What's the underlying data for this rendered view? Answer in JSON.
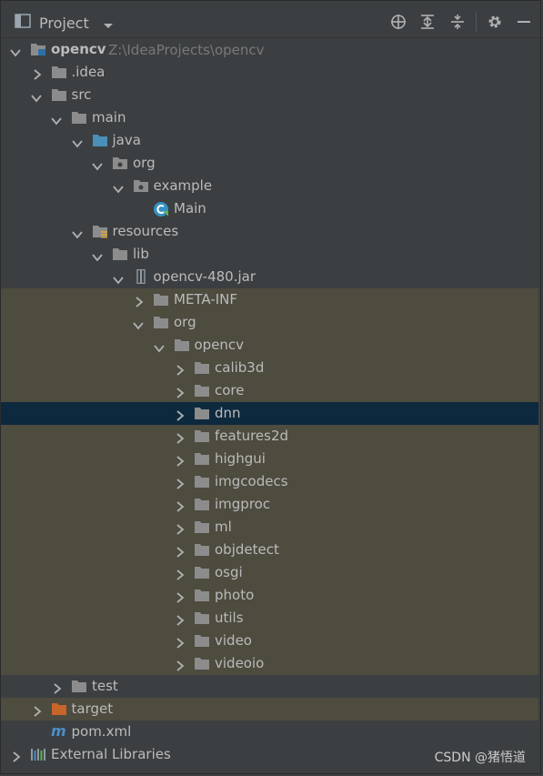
{
  "header": {
    "title": "Project",
    "icons": [
      "project-window-icon",
      "dropdown-icon",
      "locate-icon",
      "expand-all-icon",
      "collapse-all-icon",
      "gear-icon",
      "hide-icon"
    ]
  },
  "tree": [
    {
      "label": "opencv",
      "path": "Z:\\IdeaProjects\\opencv",
      "depth": 0,
      "expanded": true,
      "icon": "module-folder-icon",
      "bold": true
    },
    {
      "label": ".idea",
      "depth": 1,
      "expanded": false,
      "icon": "folder-icon"
    },
    {
      "label": "src",
      "depth": 1,
      "expanded": true,
      "icon": "folder-icon"
    },
    {
      "label": "main",
      "depth": 2,
      "expanded": true,
      "icon": "folder-icon"
    },
    {
      "label": "java",
      "depth": 3,
      "expanded": true,
      "icon": "source-folder-icon"
    },
    {
      "label": "org",
      "depth": 4,
      "expanded": true,
      "icon": "package-icon"
    },
    {
      "label": "example",
      "depth": 5,
      "expanded": true,
      "icon": "package-icon"
    },
    {
      "label": "Main",
      "depth": 6,
      "leaf": true,
      "icon": "java-class-icon"
    },
    {
      "label": "resources",
      "depth": 3,
      "expanded": true,
      "icon": "resources-folder-icon"
    },
    {
      "label": "lib",
      "depth": 4,
      "expanded": true,
      "icon": "folder-icon"
    },
    {
      "label": "opencv-480.jar",
      "depth": 5,
      "expanded": true,
      "icon": "jar-icon"
    },
    {
      "label": "META-INF",
      "depth": 6,
      "expanded": false,
      "icon": "folder-icon",
      "jar": true
    },
    {
      "label": "org",
      "depth": 6,
      "expanded": true,
      "icon": "folder-icon",
      "jar": true
    },
    {
      "label": "opencv",
      "depth": 7,
      "expanded": true,
      "icon": "folder-icon",
      "jar": true
    },
    {
      "label": "calib3d",
      "depth": 8,
      "expanded": false,
      "icon": "folder-icon",
      "jar": true
    },
    {
      "label": "core",
      "depth": 8,
      "expanded": false,
      "icon": "folder-icon",
      "jar": true
    },
    {
      "label": "dnn",
      "depth": 8,
      "expanded": false,
      "icon": "folder-icon",
      "selected": true
    },
    {
      "label": "features2d",
      "depth": 8,
      "expanded": false,
      "icon": "folder-icon",
      "jar": true
    },
    {
      "label": "highgui",
      "depth": 8,
      "expanded": false,
      "icon": "folder-icon",
      "jar": true
    },
    {
      "label": "imgcodecs",
      "depth": 8,
      "expanded": false,
      "icon": "folder-icon",
      "jar": true
    },
    {
      "label": "imgproc",
      "depth": 8,
      "expanded": false,
      "icon": "folder-icon",
      "jar": true
    },
    {
      "label": "ml",
      "depth": 8,
      "expanded": false,
      "icon": "folder-icon",
      "jar": true
    },
    {
      "label": "objdetect",
      "depth": 8,
      "expanded": false,
      "icon": "folder-icon",
      "jar": true
    },
    {
      "label": "osgi",
      "depth": 8,
      "expanded": false,
      "icon": "folder-icon",
      "jar": true
    },
    {
      "label": "photo",
      "depth": 8,
      "expanded": false,
      "icon": "folder-icon",
      "jar": true
    },
    {
      "label": "utils",
      "depth": 8,
      "expanded": false,
      "icon": "folder-icon",
      "jar": true
    },
    {
      "label": "video",
      "depth": 8,
      "expanded": false,
      "icon": "folder-icon",
      "jar": true
    },
    {
      "label": "videoio",
      "depth": 8,
      "expanded": false,
      "icon": "folder-icon",
      "jar": true
    },
    {
      "label": "test",
      "depth": 2,
      "expanded": false,
      "icon": "folder-icon",
      "dark": true
    },
    {
      "label": "target",
      "depth": 1,
      "expanded": false,
      "icon": "excluded-folder-icon",
      "jar": true
    },
    {
      "label": "pom.xml",
      "depth": 1,
      "leaf": true,
      "icon": "maven-icon"
    },
    {
      "label": "External Libraries",
      "depth": 0,
      "expanded": false,
      "icon": "libraries-icon"
    }
  ],
  "watermark": "CSDN @猪悟道",
  "colors": {
    "background": "#3c3f41",
    "jar_background": "#4e4b3f",
    "selection": "#0d293e",
    "folder": "#8c8c8c",
    "source_folder": "#4a90b8",
    "excluded_folder": "#c7652b",
    "text": "#bbbbbb",
    "path_text": "#787878"
  }
}
